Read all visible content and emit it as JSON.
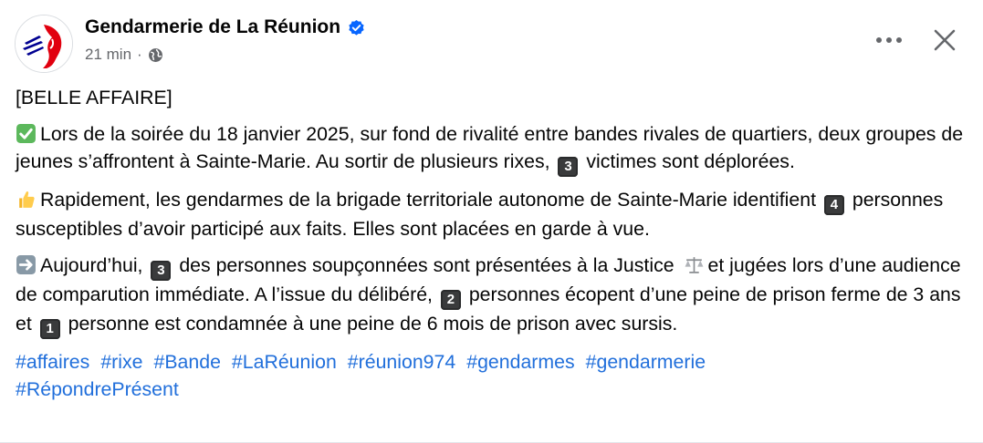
{
  "header": {
    "page_name": "Gendarmerie de La Réunion",
    "time": "21 min",
    "separator": "·"
  },
  "icons": {
    "avatar": "marianne-logo",
    "verified": "verified-badge-icon",
    "audience": "globe-icon",
    "more": "more-options-icon",
    "close": "close-icon"
  },
  "colors": {
    "link": "#216fdb",
    "verified": "#0866ff",
    "meta": "#65676b",
    "text": "#050505"
  },
  "post": {
    "title": "[BELLE AFFAIRE]",
    "p1": {
      "text_a": "Lors de la soirée du 18 janvier 2025, sur fond de rivalité entre bandes rivales de quartiers, deux groupes de jeunes s’affrontent à Sainte-Marie. Au sortir de plusieurs rixes,",
      "keycap": "3",
      "text_b": "victimes sont déplorées."
    },
    "p2": {
      "text_a": "Rapidement, les gendarmes de la brigade territoriale autonome de Sainte-Marie identifient",
      "keycap": "4",
      "text_b": "personnes susceptibles d’avoir participé aux faits. Elles sont placées en garde à vue."
    },
    "p3": {
      "text_a": "Aujourd’hui,",
      "keycap1": "3",
      "text_b": "des personnes soupçonnées sont présentées à la Justice",
      "text_c": "et jugées lors d’une audience de comparution immédiate. A l’issue du délibéré,",
      "keycap2": "2",
      "text_d": "personnes écopent d’une peine de prison ferme de 3 ans et",
      "keycap3": "1",
      "text_e": "personne est condamnée à une peine de 6 mois de prison avec sursis."
    },
    "hashtags": [
      "#affaires",
      "#rixe",
      "#Bande",
      "#LaRéunion",
      "#réunion974",
      "#gendarmes",
      "#gendarmerie",
      "#RépondrePrésent"
    ]
  }
}
